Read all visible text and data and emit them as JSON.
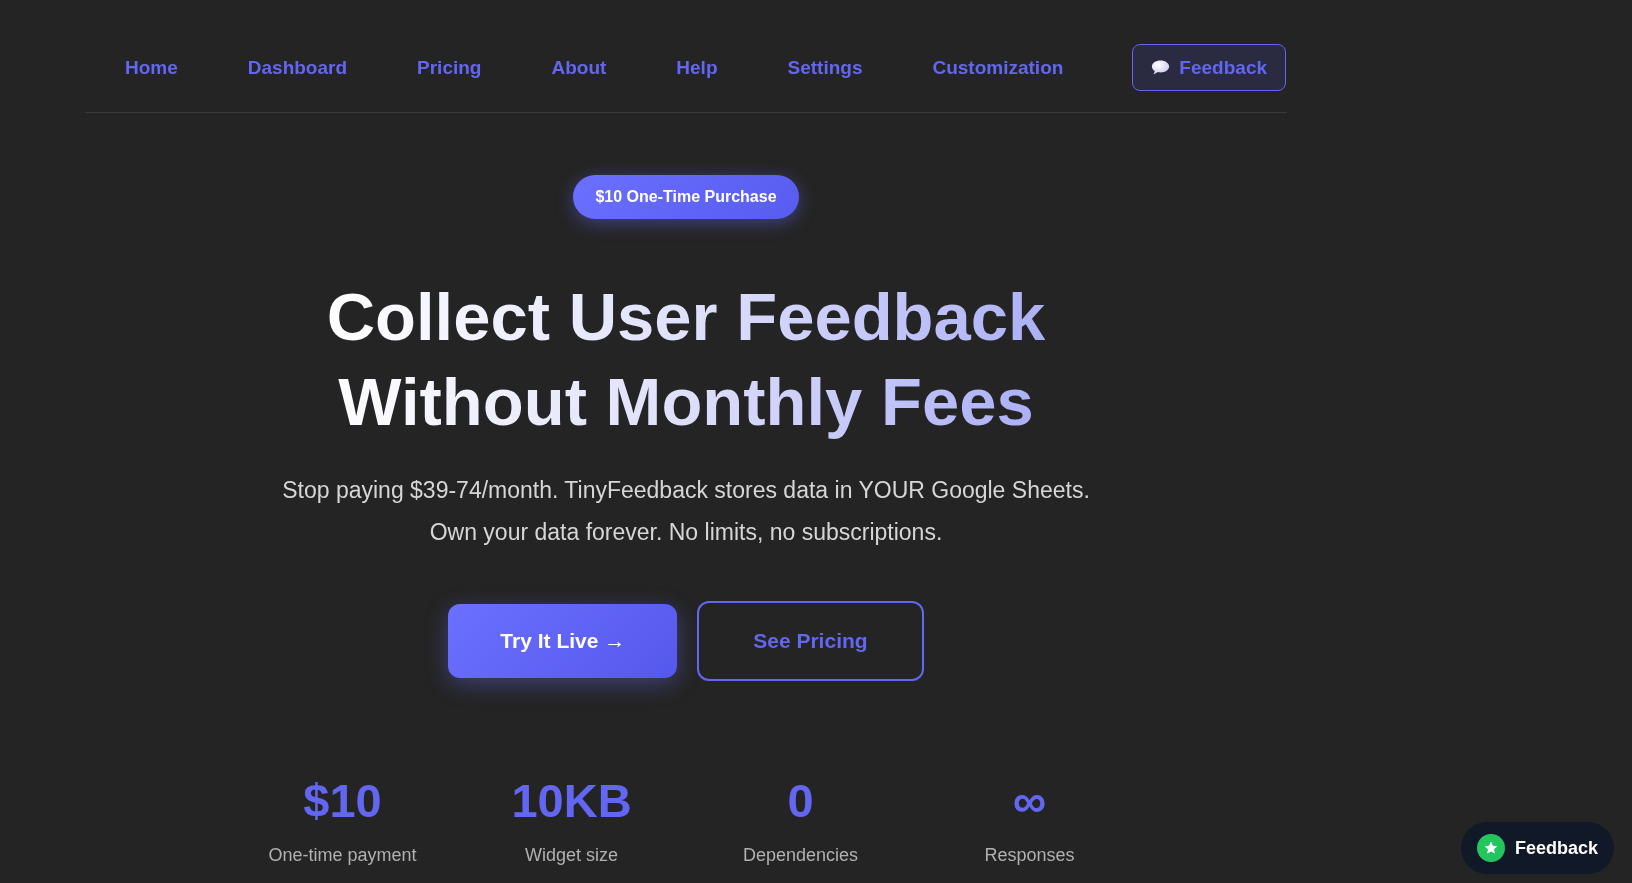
{
  "nav": {
    "links": [
      {
        "label": "Home"
      },
      {
        "label": "Dashboard"
      },
      {
        "label": "Pricing"
      },
      {
        "label": "About"
      },
      {
        "label": "Help"
      },
      {
        "label": "Settings"
      },
      {
        "label": "Customization"
      }
    ],
    "feedback_button": {
      "label": "Feedback"
    }
  },
  "hero": {
    "badge": "$10 One-Time Purchase",
    "title_lines": [
      "Collect User Feedback",
      "Without Monthly Fees"
    ],
    "subtitle_lines": [
      "Stop paying $39-74/month. TinyFeedback stores data in YOUR Google Sheets.",
      "Own your data forever. No limits, no subscriptions."
    ],
    "buttons": [
      {
        "label": "Try It Live →",
        "kind": "primary"
      },
      {
        "label": "See Pricing",
        "kind": "outline"
      }
    ]
  },
  "stats": [
    {
      "value": "$10",
      "label": "One-time payment"
    },
    {
      "value": "10KB",
      "label": "Widget size"
    },
    {
      "value": "0",
      "label": "Dependencies"
    },
    {
      "value": "∞",
      "label": "Responses"
    }
  ],
  "floating_feedback": {
    "label": "Feedback"
  }
}
